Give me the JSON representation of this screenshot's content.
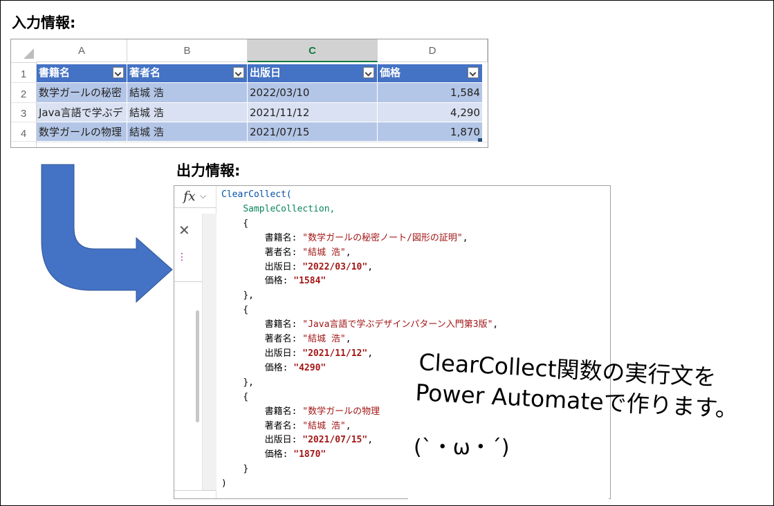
{
  "input_heading": "入力情報:",
  "output_heading": "出力情報:",
  "sheet": {
    "column_letters": [
      "A",
      "B",
      "C",
      "D"
    ],
    "row_numbers": [
      "1",
      "2",
      "3",
      "4"
    ],
    "headers": [
      "書籍名",
      "著者名",
      "出版日",
      "価格"
    ],
    "rows": [
      [
        "数学ガールの秘密",
        "結城 浩",
        "2022/03/10",
        "1,584"
      ],
      [
        "Java言語で学ぶデ",
        "結城 浩",
        "2021/11/12",
        "4,290"
      ],
      [
        "数学ガールの物理",
        "結城 浩",
        "2021/07/15",
        "1,870"
      ]
    ],
    "selected_column": "C"
  },
  "editor": {
    "fx_label": "fx",
    "function_name": "ClearCollect(",
    "collection_name": "SampleCollection,",
    "closing": ")",
    "records": [
      {
        "title_key": "書籍名: ",
        "title": "\"数学ガールの秘密ノート/図形の証明\"",
        "author_key": "著者名: ",
        "author": "\"結城 浩\"",
        "date_key": "出版日: ",
        "date": "\"2022/03/10\"",
        "price_key": "価格: ",
        "price": "\"1584\"",
        "close": "},"
      },
      {
        "title_key": "書籍名: ",
        "title": "\"Java言語で学ぶデザインパターン入門第3版\"",
        "author_key": "著者名: ",
        "author": "\"結城 浩\"",
        "date_key": "出版日: ",
        "date": "\"2021/11/12\"",
        "price_key": "価格: ",
        "price": "\"4290\"",
        "close": "},"
      },
      {
        "title_key": "書籍名: ",
        "title": "\"数学ガールの物理",
        "author_key": "著者名: ",
        "author": "\"結城 浩\"",
        "date_key": "出版日: ",
        "date": "\"2021/07/15\"",
        "price_key": "価格: ",
        "price": "\"1870\"",
        "close": "}"
      }
    ]
  },
  "note": {
    "line1": "ClearCollect関数の実行文を",
    "line2": "Power Automateで作ります。",
    "face": "(`・ω・´)"
  },
  "colors": {
    "table_header": "#4472c4",
    "band_dark": "#b4c6e7",
    "band_light": "#d9e1f2",
    "arrow": "#4472c4",
    "excel_green": "#107c41"
  }
}
